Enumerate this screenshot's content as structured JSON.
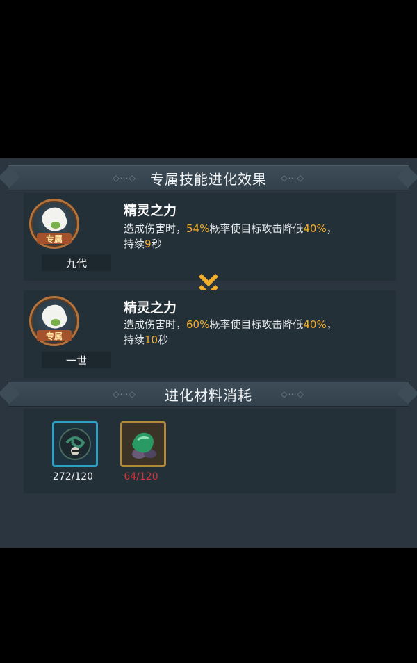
{
  "sections": {
    "effect_title": "专属技能进化效果",
    "material_title": "进化材料消耗"
  },
  "before": {
    "badge": "专属",
    "tier": "九代",
    "name": "精灵之力",
    "desc_a": "造成伤害时，",
    "chance": "54%",
    "desc_b": "概率使目标攻击降低",
    "reduce": "40%",
    "desc_c": "，",
    "desc_d": "持续",
    "duration": "9",
    "desc_e": "秒"
  },
  "after": {
    "badge": "专属",
    "tier": "一世",
    "name": "精灵之力",
    "desc_a": "造成伤害时，",
    "chance": "60%",
    "desc_b": "概率使目标攻击降低",
    "reduce": "40%",
    "desc_c": "，",
    "desc_d": "持续",
    "duration": "10",
    "desc_e": "秒"
  },
  "arrow_icon": "double-chevron-down-icon",
  "materials": [
    {
      "icon": "soul-stone-icon",
      "count": "272/120",
      "count_color": "#eef1f3",
      "frame_color": "#2f9fc4"
    },
    {
      "icon": "green-gem-icon",
      "count": "64/120",
      "count_color": "#d8323a",
      "frame_color": "#b08a3a"
    }
  ],
  "colors": {
    "highlight": "#f2ad2b",
    "insufficient": "#d8323a",
    "panel": "#2a3540"
  }
}
